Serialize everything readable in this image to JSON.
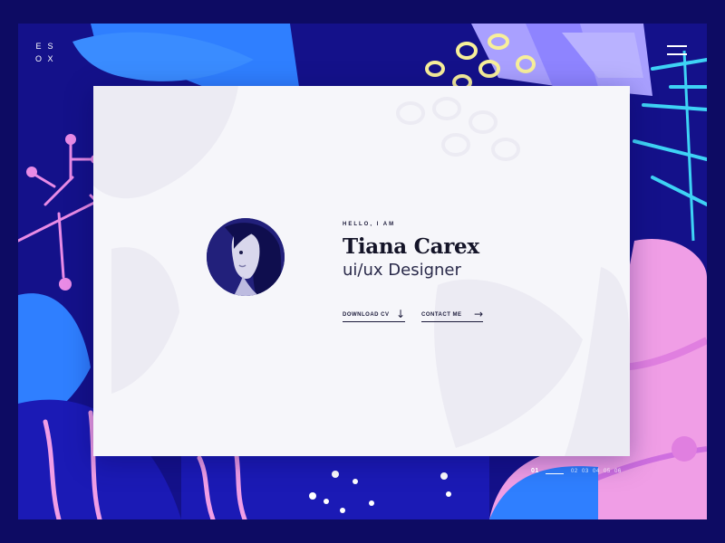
{
  "brand": {
    "letters": [
      "E",
      "S",
      "O",
      "X"
    ]
  },
  "hero": {
    "greeting": "HELLO, I AM",
    "name": "Tiana Carex",
    "role": "ui/ux Designer",
    "download_label": "DOWNLOAD CV",
    "contact_label": "CONTACT ME",
    "download_icon": "arrow-down-icon",
    "contact_icon": "arrow-right-icon"
  },
  "pager": {
    "items": [
      "01",
      "02",
      "03",
      "04",
      "05",
      "06"
    ],
    "active": "01"
  },
  "colors": {
    "background": "#14118a",
    "card": "#f6f6fa",
    "blue": "#2f7fff",
    "navy": "#1b1ab5",
    "pink": "#f09ee6",
    "lavender": "#a9a0ff",
    "yellow": "#f7ef9a",
    "cyan": "#3ed3f5",
    "text_dark": "#141428"
  },
  "icons": {
    "menu": "hamburger-menu-icon"
  }
}
